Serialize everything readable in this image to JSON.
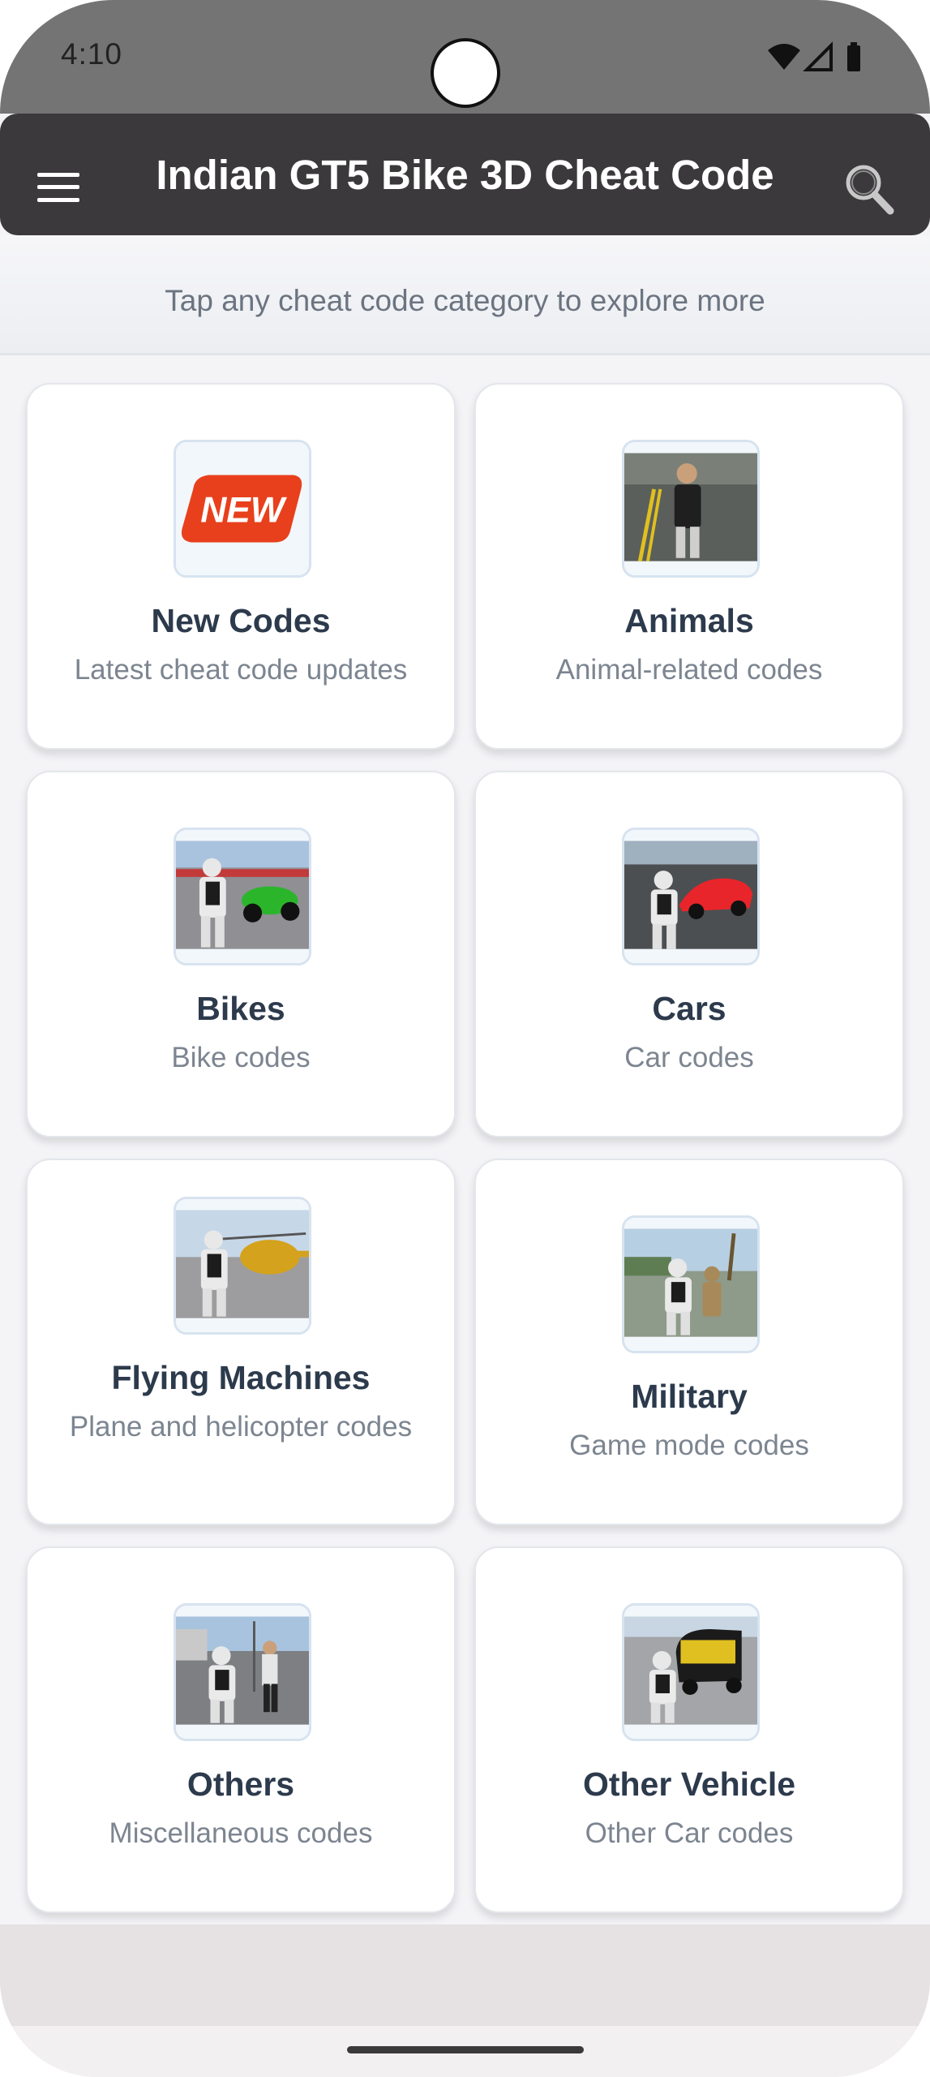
{
  "status_bar": {
    "time": "4:10"
  },
  "app_bar": {
    "title": "Indian GT5 Bike 3D Cheat Code"
  },
  "subtitle": "Tap any cheat code category to explore more",
  "categories": [
    {
      "title": "New Codes",
      "desc": "Latest cheat code updates",
      "icon": "new-badge",
      "badge_text": "NEW"
    },
    {
      "title": "Animals",
      "desc": "Animal-related codes",
      "icon": "animals-thumbnail"
    },
    {
      "title": "Bikes",
      "desc": "Bike codes",
      "icon": "bikes-thumbnail"
    },
    {
      "title": "Cars",
      "desc": "Car codes",
      "icon": "cars-thumbnail"
    },
    {
      "title": "Flying Machines",
      "desc": "Plane and helicopter codes",
      "icon": "flying-machines-thumbnail"
    },
    {
      "title": "Military",
      "desc": "Game mode codes",
      "icon": "military-thumbnail"
    },
    {
      "title": "Others",
      "desc": "Miscellaneous codes",
      "icon": "others-thumbnail"
    },
    {
      "title": "Other Vehicle",
      "desc": "Other Car codes",
      "icon": "other-vehicle-thumbnail"
    }
  ],
  "colors": {
    "app_bar": "#3b393b",
    "title_text": "#2c3a4c",
    "desc_text": "#7c8590",
    "new_badge": "#e8401c"
  }
}
